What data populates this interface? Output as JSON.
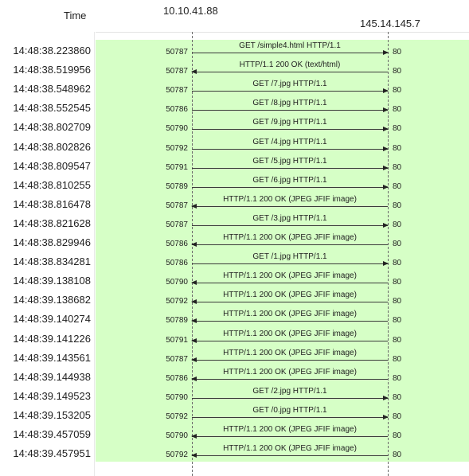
{
  "header": {
    "time_label": "Time",
    "left_host": "10.10.41.88",
    "right_host": "145.14.145.7"
  },
  "colors": {
    "band": "#d6ffc6",
    "line": "#3a3a3a"
  },
  "rows": [
    {
      "time": "14:48:38.223860",
      "left_port": "50787",
      "label": "GET /simple4.html HTTP/1.1",
      "right_port": "80",
      "dir": "right"
    },
    {
      "time": "14:48:38.519956",
      "left_port": "50787",
      "label": "HTTP/1.1 200 OK  (text/html)",
      "right_port": "80",
      "dir": "left"
    },
    {
      "time": "14:48:38.548962",
      "left_port": "50787",
      "label": "GET /7.jpg HTTP/1.1",
      "right_port": "80",
      "dir": "right"
    },
    {
      "time": "14:48:38.552545",
      "left_port": "50786",
      "label": "GET /8.jpg HTTP/1.1",
      "right_port": "80",
      "dir": "right"
    },
    {
      "time": "14:48:38.802709",
      "left_port": "50790",
      "label": "GET /9.jpg HTTP/1.1",
      "right_port": "80",
      "dir": "right"
    },
    {
      "time": "14:48:38.802826",
      "left_port": "50792",
      "label": "GET /4.jpg HTTP/1.1",
      "right_port": "80",
      "dir": "right"
    },
    {
      "time": "14:48:38.809547",
      "left_port": "50791",
      "label": "GET /5.jpg HTTP/1.1",
      "right_port": "80",
      "dir": "right"
    },
    {
      "time": "14:48:38.810255",
      "left_port": "50789",
      "label": "GET /6.jpg HTTP/1.1",
      "right_port": "80",
      "dir": "right"
    },
    {
      "time": "14:48:38.816478",
      "left_port": "50787",
      "label": "HTTP/1.1 200 OK  (JPEG JFIF image)",
      "right_port": "80",
      "dir": "left"
    },
    {
      "time": "14:48:38.821628",
      "left_port": "50787",
      "label": "GET /3.jpg HTTP/1.1",
      "right_port": "80",
      "dir": "right"
    },
    {
      "time": "14:48:38.829946",
      "left_port": "50786",
      "label": "HTTP/1.1 200 OK  (JPEG JFIF image)",
      "right_port": "80",
      "dir": "left"
    },
    {
      "time": "14:48:38.834281",
      "left_port": "50786",
      "label": "GET /1.jpg HTTP/1.1",
      "right_port": "80",
      "dir": "right"
    },
    {
      "time": "14:48:39.138108",
      "left_port": "50790",
      "label": "HTTP/1.1 200 OK  (JPEG JFIF image)",
      "right_port": "80",
      "dir": "left"
    },
    {
      "time": "14:48:39.138682",
      "left_port": "50792",
      "label": "HTTP/1.1 200 OK  (JPEG JFIF image)",
      "right_port": "80",
      "dir": "left"
    },
    {
      "time": "14:48:39.140274",
      "left_port": "50789",
      "label": "HTTP/1.1 200 OK  (JPEG JFIF image)",
      "right_port": "80",
      "dir": "left"
    },
    {
      "time": "14:48:39.141226",
      "left_port": "50791",
      "label": "HTTP/1.1 200 OK  (JPEG JFIF image)",
      "right_port": "80",
      "dir": "left"
    },
    {
      "time": "14:48:39.143561",
      "left_port": "50787",
      "label": "HTTP/1.1 200 OK  (JPEG JFIF image)",
      "right_port": "80",
      "dir": "left"
    },
    {
      "time": "14:48:39.144938",
      "left_port": "50786",
      "label": "HTTP/1.1 200 OK  (JPEG JFIF image)",
      "right_port": "80",
      "dir": "left"
    },
    {
      "time": "14:48:39.149523",
      "left_port": "50790",
      "label": "GET /2.jpg HTTP/1.1",
      "right_port": "80",
      "dir": "right"
    },
    {
      "time": "14:48:39.153205",
      "left_port": "50792",
      "label": "GET /0.jpg HTTP/1.1",
      "right_port": "80",
      "dir": "right"
    },
    {
      "time": "14:48:39.457059",
      "left_port": "50790",
      "label": "HTTP/1.1 200 OK  (JPEG JFIF image)",
      "right_port": "80",
      "dir": "left"
    },
    {
      "time": "14:48:39.457951",
      "left_port": "50792",
      "label": "HTTP/1.1 200 OK  (JPEG JFIF image)",
      "right_port": "80",
      "dir": "left"
    }
  ]
}
